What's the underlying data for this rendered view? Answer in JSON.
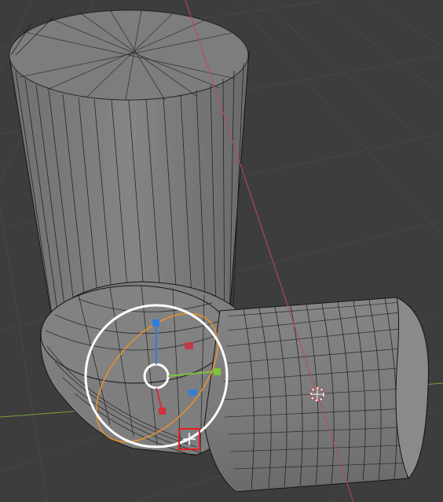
{
  "viewport": {
    "mode": "edit",
    "object": "bent-pipe-mesh",
    "selection": "loop",
    "active_tool": "move-gizmo"
  },
  "colors": {
    "background": "#3d3d3d",
    "grid": "#474747",
    "mesh_fill": "#7b7b7b",
    "mesh_edge": "#151515",
    "x_axis": "#c0494f",
    "y_axis": "#7aa035",
    "selection": "#e8922a",
    "gizmo_white": "#ffffff",
    "gizmo_blue": "#2c7de0",
    "gizmo_red": "#d03040",
    "gizmo_green": "#7ec43a"
  },
  "icons": {
    "cursor": "3d-cursor-icon",
    "move_handle": "move-handle-icon"
  }
}
